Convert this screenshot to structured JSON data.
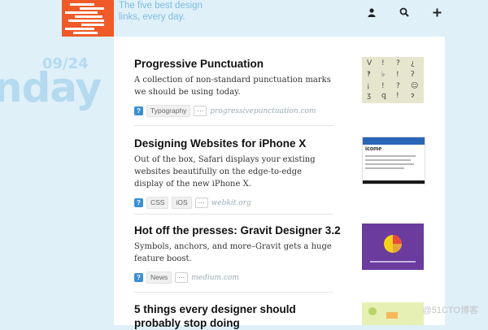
{
  "header": {
    "tagline_line1": "The five best design",
    "tagline_line2": "links, every day.",
    "icons": [
      "user-icon",
      "search-icon",
      "plus-icon"
    ]
  },
  "date": {
    "small": "09/24",
    "big": "nday"
  },
  "articles": [
    {
      "title": "Progressive Punctuation",
      "desc": "A collection of non-standard punctuation marks we should be using today.",
      "tags": [
        "Typography"
      ],
      "more": "···",
      "source": "progressivepunctuation.com"
    },
    {
      "title": "Designing Websites for iPhone X",
      "desc": "Out of the box, Safari displays your existing websites beautifully on the edge-to-edge display of the new iPhone X.",
      "tags": [
        "CSS",
        "iOS"
      ],
      "more": "···",
      "source": "webkit.org"
    },
    {
      "title": "Hot off the presses: Gravit Designer 3.2",
      "desc": "Symbols, anchors, and more–Gravit gets a huge feature boost.",
      "tags": [
        "News"
      ],
      "more": "···",
      "source": "medium.com"
    },
    {
      "title": "5 things every designer should probably stop doing"
    }
  ],
  "thumb2": {
    "heading": "icome"
  },
  "watermark": "@51CTO博客",
  "colors": {
    "background": "#dff0f9",
    "logo": "#f05a28",
    "tagline": "#7dbde0",
    "date": "#b5daf0",
    "tag_icon": "#3b8fd4"
  }
}
